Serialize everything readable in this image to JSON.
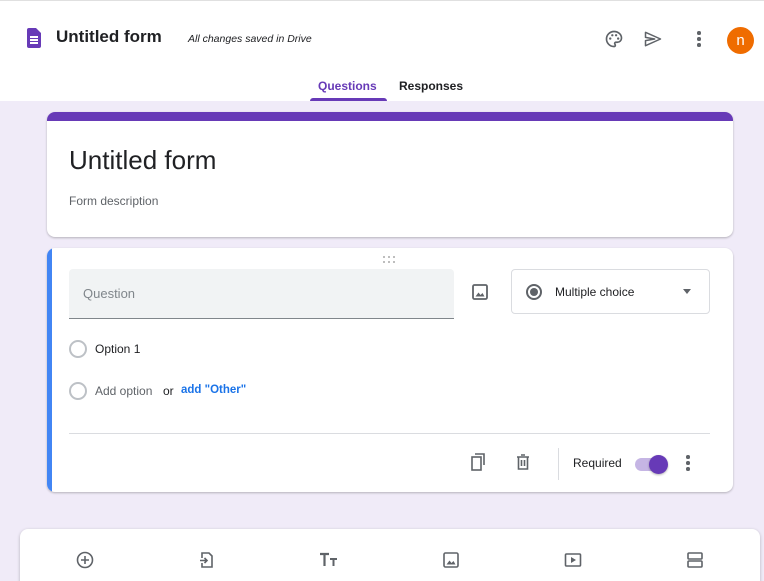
{
  "header": {
    "app_title": "Untitled form",
    "save_status": "All changes saved in Drive",
    "avatar_initial": "n"
  },
  "tabs": [
    {
      "label": "Questions",
      "active": true
    },
    {
      "label": "Responses",
      "active": false
    }
  ],
  "form": {
    "title": "Untitled form",
    "description_placeholder": "Form description"
  },
  "question": {
    "placeholder": "Question",
    "type_label": "Multiple choice",
    "options": [
      {
        "label": "Option 1"
      }
    ],
    "add_option_label": "Add option",
    "or_label": "or",
    "add_other_label": "add \"Other\"",
    "required_label": "Required",
    "required_on": true
  },
  "toolbar": {
    "icons": [
      "add-question-icon",
      "import-questions-icon",
      "add-title-icon",
      "add-image-icon",
      "add-video-icon",
      "add-section-icon"
    ]
  },
  "colors": {
    "accent": "#673ab7",
    "question_focus": "#4285f4",
    "background": "#f0ebf8",
    "avatar": "#ef6c00",
    "link": "#1a73e8"
  }
}
